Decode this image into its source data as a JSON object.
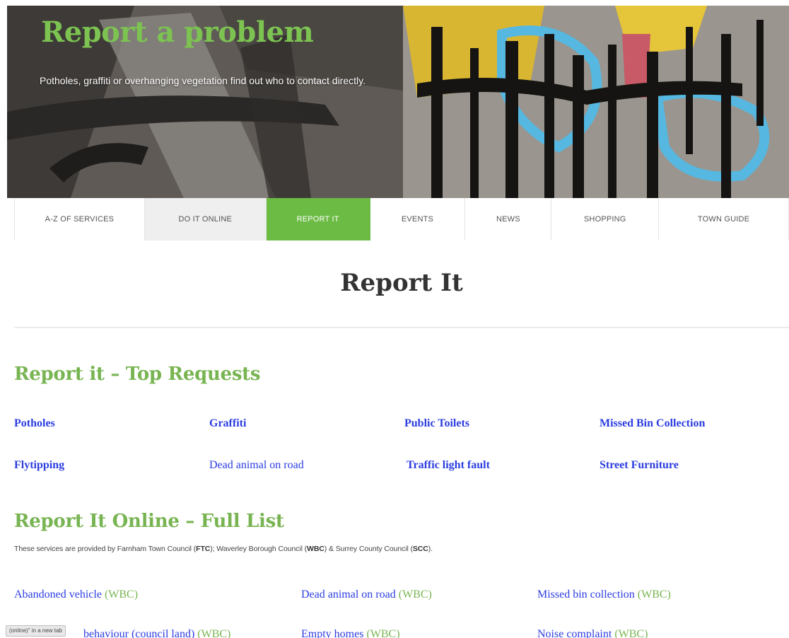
{
  "hero": {
    "title": "Report a problem",
    "subtitle": "Potholes, graffiti or overhanging vegetation find out who to contact directly."
  },
  "nav": {
    "tabs": [
      {
        "label": "A-Z OF SERVICES"
      },
      {
        "label": "DO IT ONLINE"
      },
      {
        "label": "REPORT IT",
        "active": true
      },
      {
        "label": "EVENTS"
      },
      {
        "label": "NEWS"
      },
      {
        "label": "SHOPPING"
      },
      {
        "label": "TOWN GUIDE"
      }
    ]
  },
  "page_title": "Report It",
  "top_requests": {
    "heading": "Report it – Top Requests",
    "links": [
      "Potholes",
      "Graffiti",
      "Public Toilets",
      "Missed Bin Collection",
      "Flytipping",
      "Dead animal on road",
      "Traffic light fault",
      "Street Furniture"
    ]
  },
  "full_list": {
    "heading": "Report It Online – Full List",
    "intro": {
      "prefix": "These services are provided by Farnham Town Council (",
      "ftc": "FTC",
      "mid1": "); Waverley Borough Council (",
      "wbc": "WBC",
      "mid2": ") & Surrey County Council (",
      "scc": "SCC",
      "suffix": ")."
    },
    "items": [
      {
        "label": "Abandoned vehicle",
        "council": "(WBC)"
      },
      {
        "label": "Dead animal on road",
        "council": "(WBC)"
      },
      {
        "label": "Missed bin collection",
        "council": "(WBC)"
      },
      {
        "label": "behaviour (council land)",
        "council": "(WBC)"
      },
      {
        "label": "Empty homes",
        "council": "(WBC)"
      },
      {
        "label": "Noise complaint",
        "council": "(WBC)"
      }
    ]
  },
  "status_tooltip": "(online)\" in a new tab",
  "colors": {
    "accent_green": "#6cbb45",
    "heading_green": "#78b452",
    "link_blue": "#2b3de0"
  }
}
